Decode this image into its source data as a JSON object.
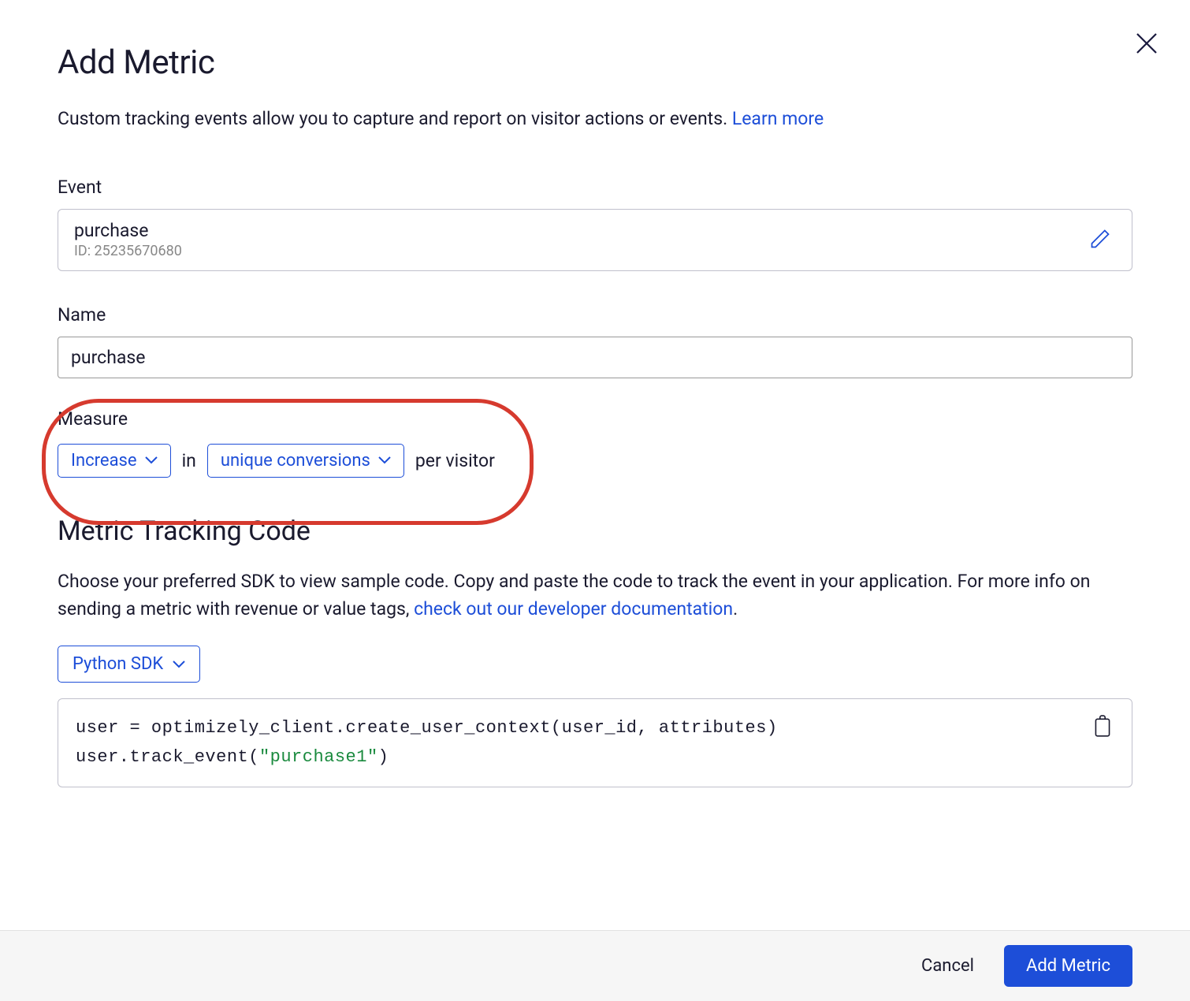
{
  "header": {
    "title": "Add Metric",
    "subtitle_text": "Custom tracking events allow you to capture and report on visitor actions or events. ",
    "learn_more": "Learn more"
  },
  "event": {
    "label": "Event",
    "name": "purchase",
    "id_prefix": "ID: ",
    "id": "25235670680"
  },
  "name_field": {
    "label": "Name",
    "value": "purchase"
  },
  "measure": {
    "label": "Measure",
    "direction": "Increase",
    "connector1": "in",
    "aggregation": "unique conversions",
    "suffix": "per visitor"
  },
  "tracking": {
    "title": "Metric Tracking Code",
    "desc_text": "Choose your preferred SDK to view sample code. Copy and paste the code to track the event in your application. For more info on sending a metric with revenue or value tags, ",
    "doc_link": "check out our developer documentation",
    "desc_suffix": ".",
    "sdk": "Python SDK",
    "code_line1": "user = optimizely_client.create_user_context(user_id, attributes)",
    "code_line2_prefix": "user.track_event(",
    "code_line2_string": "\"purchase1\"",
    "code_line2_suffix": ")"
  },
  "footer": {
    "cancel": "Cancel",
    "submit": "Add Metric"
  }
}
